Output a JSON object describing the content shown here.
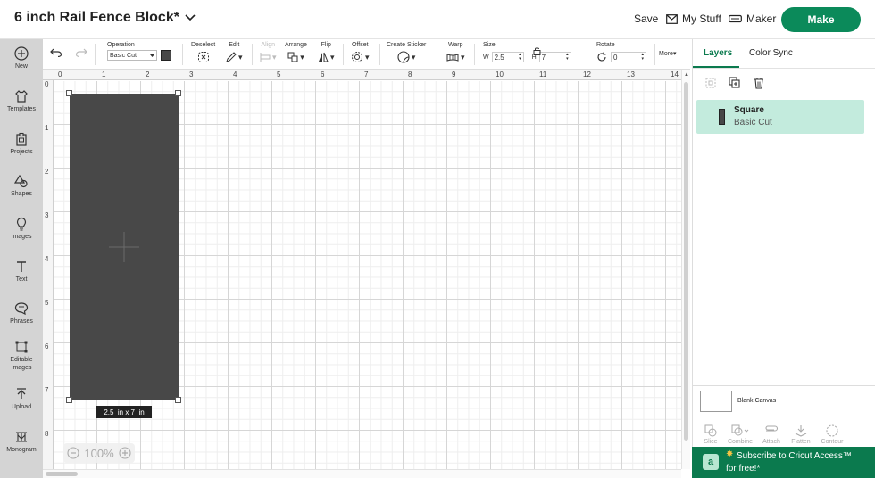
{
  "header": {
    "title": "6 inch Rail Fence Block*",
    "save_label": "Save",
    "mystuff_label": "My Stuff",
    "maker_label": "Maker",
    "make_label": "Make"
  },
  "toolbar": {
    "operation_label": "Operation",
    "operation_value": "Basic Cut",
    "deselect_label": "Deselect",
    "edit_label": "Edit",
    "align_label": "Align",
    "arrange_label": "Arrange",
    "flip_label": "Flip",
    "offset_label": "Offset",
    "sticker_label": "Create Sticker",
    "warp_label": "Warp",
    "size_label": "Size",
    "w_label": "W",
    "w_value": "2.5",
    "h_label": "H",
    "h_value": "7",
    "rotate_label": "Rotate",
    "rotate_value": "0",
    "more_label": "More"
  },
  "sidebar": {
    "items": [
      {
        "label": "New"
      },
      {
        "label": "Templates"
      },
      {
        "label": "Projects"
      },
      {
        "label": "Shapes"
      },
      {
        "label": "Images"
      },
      {
        "label": "Text"
      },
      {
        "label": "Phrases"
      },
      {
        "label": "Editable",
        "label2": "Images"
      },
      {
        "label": "Upload"
      },
      {
        "label": "Monogram"
      }
    ]
  },
  "canvas": {
    "ruler_h": [
      "0",
      "1",
      "2",
      "3",
      "4",
      "5",
      "6",
      "7",
      "8",
      "9",
      "10",
      "11",
      "12",
      "13",
      "14"
    ],
    "ruler_v": [
      "0",
      "1",
      "2",
      "3",
      "4",
      "5",
      "6",
      "7",
      "8"
    ],
    "size_label": "2.5  in x 7  in",
    "zoom": "100%",
    "shape_color": "#484848"
  },
  "panel": {
    "tabs": [
      "Layers",
      "Color Sync"
    ],
    "layer": {
      "name": "Square",
      "operation": "Basic Cut"
    },
    "blank_canvas": "Blank Canvas",
    "bottom_actions": [
      "Slice",
      "Combine",
      "Attach",
      "Flatten",
      "Contour"
    ]
  },
  "promo": {
    "text1": "Subscribe to Cricut Access™",
    "text2": "for free!*"
  },
  "colors": {
    "accent": "#0b8a5a",
    "layer_selected": "#c3ebdd",
    "sidebar": "#d4d4d4"
  }
}
